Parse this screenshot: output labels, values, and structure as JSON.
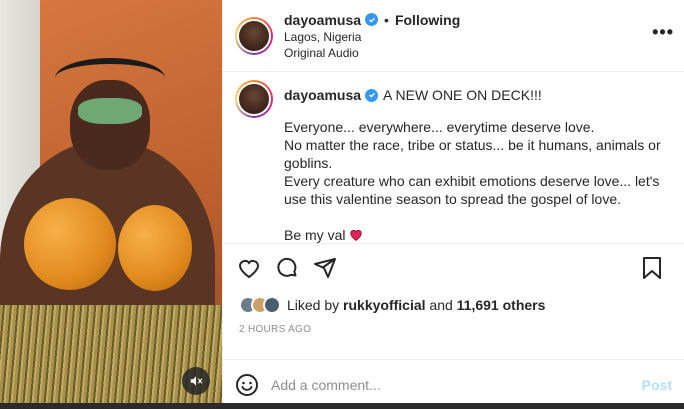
{
  "post": {
    "username": "dayoamusa",
    "follow_label": "Following",
    "location": "Lagos, Nigeria",
    "audio": "Original Audio",
    "more_icon": "more-horizontal-icon"
  },
  "caption": {
    "username": "dayoamusa",
    "headline": "A NEW ONE ON DECK!!!",
    "lines": [
      "Everyone... everywhere... everytime deserve love.",
      "No matter the race, tribe or status... be it humans, animals or goblins.",
      "Every creature who can exhibit emotions deserve love... let's use this valentine season to spread the gospel of love.",
      "Be my val"
    ]
  },
  "likes": {
    "prefix": "Liked by",
    "user": "rukkyofficial",
    "middle": "and",
    "count": "11,691 others"
  },
  "time": "2 HOURS AGO",
  "comment": {
    "placeholder": "Add a comment...",
    "post_label": "Post"
  },
  "colors": {
    "verified": "#3897f0",
    "post_button": "#b2dffc",
    "muted_text": "#8e8e8e"
  }
}
